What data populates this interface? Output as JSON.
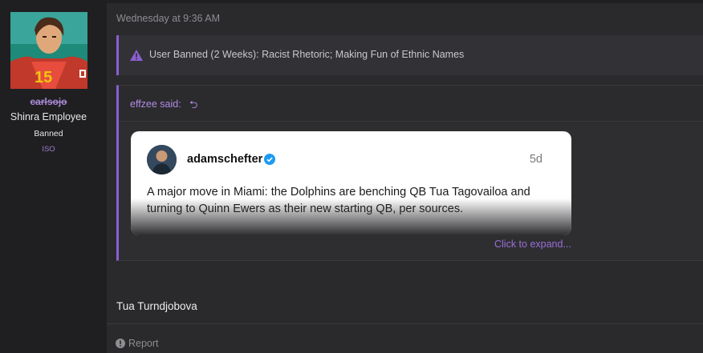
{
  "user": {
    "username": "carlsojo",
    "title": "Shinra Employee",
    "status": "Banned",
    "tag": "ISO",
    "avatar_icon": "user-avatar-image"
  },
  "post": {
    "timestamp": "Wednesday at 9:36 AM",
    "ban_notice": {
      "icon": "warning-icon",
      "text": "User Banned (2 Weeks): Racist Rhetoric; Making Fun of Ethnic Names"
    },
    "quote": {
      "author_label": "effzee said:",
      "jump_icon": "⮌",
      "embed": {
        "handle": "adamschefter",
        "verified_icon": "verified-badge-icon",
        "age": "5d",
        "text": "A major move in Miami: the Dolphins are benching QB Tua Tagovailoa and turning to Quinn Ewers as their new starting QB, per sources."
      },
      "expand_label": "Click to expand..."
    },
    "reply_text": "Tua Turndjobova",
    "report_label": "Report"
  },
  "colors": {
    "accent": "#8a5fd0",
    "link": "#b28be4",
    "background": "#1f1f21",
    "panel": "#2a2a2d"
  }
}
